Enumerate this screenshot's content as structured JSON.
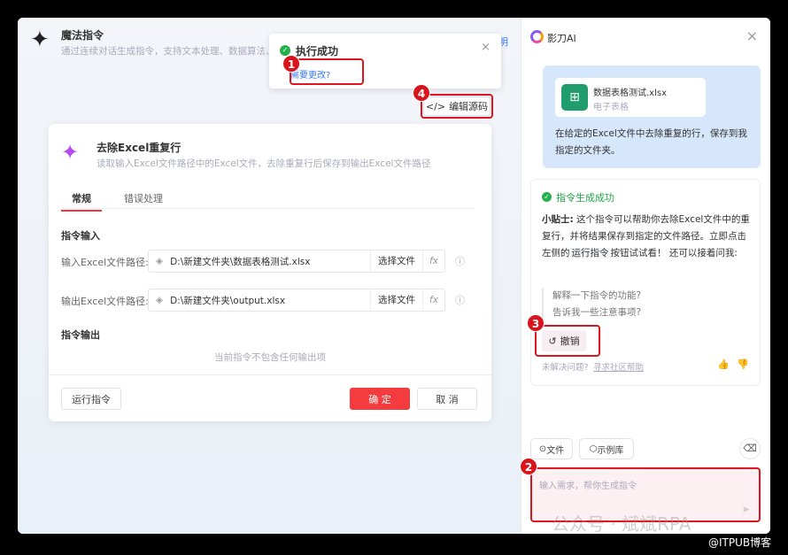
{
  "header": {
    "title": "魔法指令",
    "subtitle": "通过连续对话生成指令，支持文本处理、数据算法、Ex",
    "right_link": "明"
  },
  "toast": {
    "title": "执行成功",
    "link": "需要更改?"
  },
  "edit_source": "编辑源码",
  "badges": [
    "1",
    "2",
    "3",
    "4"
  ],
  "card": {
    "title": "去除Excel重复行",
    "desc": "读取输入Excel文件路径中的Excel文件，去除重复行后保存到输出Excel文件路径",
    "tabs": [
      "常规",
      "错误处理"
    ],
    "input_section": "指令输入",
    "fields": [
      {
        "label": "输入Excel文件路径:",
        "value": "D:\\新建文件夹\\数据表格测试.xlsx",
        "choose": "选择文件",
        "fx": "fx"
      },
      {
        "label": "输出Excel文件路径:",
        "value": "D:\\新建文件夹\\output.xlsx",
        "choose": "选择文件",
        "fx": "fx"
      }
    ],
    "output_section": "指令输出",
    "empty_output": "当前指令不包含任何输出项",
    "run": "运行指令",
    "ok": "确 定",
    "cancel": "取 消"
  },
  "ai": {
    "title": "影刀AI",
    "file_name": "数据表格测试.xlsx",
    "file_type": "电子表格",
    "user_msg": "在给定的Excel文件中去除重复的行，保存到我指定的文件夹。",
    "success": "指令生成成功",
    "tip_label": "小贴士:",
    "tip_a": " 这个指令可以帮助你去除Excel文件中的重复行，并将结果保存到指定的文件路径。立即点击左侧的",
    "tip_code": "运行指令",
    "tip_b": "按钮试试看！ 还可以接着问我:",
    "suggestions": [
      "解释一下指令的功能?",
      "告诉我一些注意事项?"
    ],
    "undo": "撤销",
    "unresolved": "未解决问题?",
    "community": "寻求社区帮助",
    "file_btn": "文件",
    "example_btn": "示例库",
    "placeholder": "输入需求，帮你生成指令"
  },
  "watermark": "公众号 · 斌斌RPA",
  "credit": "@ITPUB博客"
}
